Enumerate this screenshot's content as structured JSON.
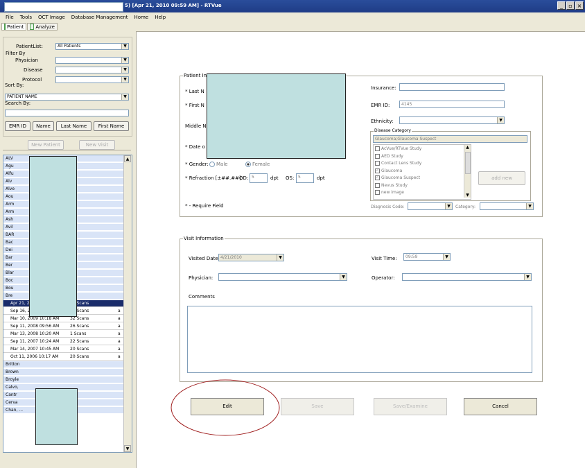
{
  "window": {
    "title": "5) [Apr 21, 2010 09:59 AM] - RTVue",
    "controls": [
      "_",
      "▫",
      "×"
    ]
  },
  "menu": [
    "File",
    "Tools",
    "OCT Image",
    "Database Management",
    "Home",
    "Help"
  ],
  "tabs": [
    "Patient",
    "Analyze"
  ],
  "left": {
    "patient_list_label": "PatientList:",
    "patient_list_value": "All Patients",
    "filter_by_label": "Filter By",
    "physician_label": "Physician",
    "disease_label": "Disease",
    "protocol_label": "Protocol",
    "sort_by_label": "Sort By:",
    "sort_by_value": "PATIENT NAME",
    "search_by_label": "Search By:",
    "search_value": "",
    "btn_emr": "EMR ID",
    "btn_name": "Name",
    "btn_last": "Last Name",
    "btn_first": "First Name",
    "btn_new_patient": "New Patient",
    "btn_new_visit": "New Visit",
    "patients_top": [
      "ALV",
      "Agu",
      "Alfu",
      "Alv",
      "Alve",
      "Aou",
      "Arm",
      "Arm",
      "Ash",
      "Avil",
      "BAR",
      "Bac",
      "Dei",
      "Bar",
      "Ber",
      "Blar",
      "Boc",
      "Bou",
      "Bre"
    ],
    "visits": [
      {
        "date": "Apr 21, 2010 09:59 AM",
        "scans": "32 Scans",
        "x": ""
      },
      {
        "date": "Sep 16, 2009 10:40 AM",
        "scans": "37 Scans",
        "x": "a"
      },
      {
        "date": "Mar 10, 2009 10:18 AM",
        "scans": "32 Scans",
        "x": "a"
      },
      {
        "date": "Sep 11, 2008 09:56 AM",
        "scans": "26 Scans",
        "x": "a"
      },
      {
        "date": "Mar 13, 2008 10:20 AM",
        "scans": "1 Scans",
        "x": "a"
      },
      {
        "date": "Sep 11, 2007 10:24 AM",
        "scans": "22 Scans",
        "x": "a"
      },
      {
        "date": "Mar 14, 2007 10:45 AM",
        "scans": "20 Scans",
        "x": "a"
      },
      {
        "date": "Oct 11, 2006 10:17 AM",
        "scans": "20 Scans",
        "x": "a"
      }
    ],
    "patients_bottom": [
      "Britton",
      "Brown",
      "Broyle",
      "Calvo,",
      "Cantr",
      "Cerva",
      "Chan, ..."
    ]
  },
  "patient_info": {
    "legend": "Patient In",
    "last_name_label": "* Last N",
    "first_name_label": "* First N",
    "middle_name_label": "Middle N",
    "dob_label": "* Date o",
    "gender_label": "* Gender:",
    "male": "Male",
    "female": "Female",
    "refraction_label": "* Refraction [±##.##]:",
    "od_label": "OD:",
    "od_value": "5",
    "os_label": "OS:",
    "os_value": "5",
    "dpt": "dpt",
    "required_note": "* - Require Field",
    "insurance_label": "Insurance:",
    "insurance_value": "",
    "emr_label": "EMR ID:",
    "emr_value": "4145",
    "ethnicity_label": "Ethnicity:",
    "ethnicity_value": "",
    "disease_category_label": "Disease Category",
    "disease_category_value": "Glaucoma;Glaucoma Suspect",
    "categories": [
      {
        "label": "AcVue/RTVue Study",
        "checked": false
      },
      {
        "label": "AED Study",
        "checked": false
      },
      {
        "label": "Contact Lens Study",
        "checked": false
      },
      {
        "label": "Glaucoma",
        "checked": true
      },
      {
        "label": "Glaucoma Suspect",
        "checked": true
      },
      {
        "label": "Nevus Study",
        "checked": false
      },
      {
        "label": "new image",
        "checked": false
      }
    ],
    "add_new": "add new",
    "diagnosis_code_label": "Diagnosis Code:",
    "category_label": "Category:"
  },
  "visit_info": {
    "legend": "Visit Information",
    "visited_date_label": "Visited Date:",
    "visited_date_value": "4/21/2010",
    "visit_time_label": "Visit Time:",
    "visit_time_value": "09:59",
    "physician_label": "Physician:",
    "operator_label": "Operator:",
    "comments_label": "Comments",
    "comments_value": ""
  },
  "actions": {
    "edit": "Edit",
    "save": "Save",
    "save_examine": "Save/Examine",
    "cancel": "Cancel"
  },
  "colors": {
    "titlebar": "#1f3c86",
    "selection": "#1a2c6b",
    "row": "#d9e4f7",
    "redact": "#bfe0e0",
    "annotation_circle": "#a02020"
  }
}
